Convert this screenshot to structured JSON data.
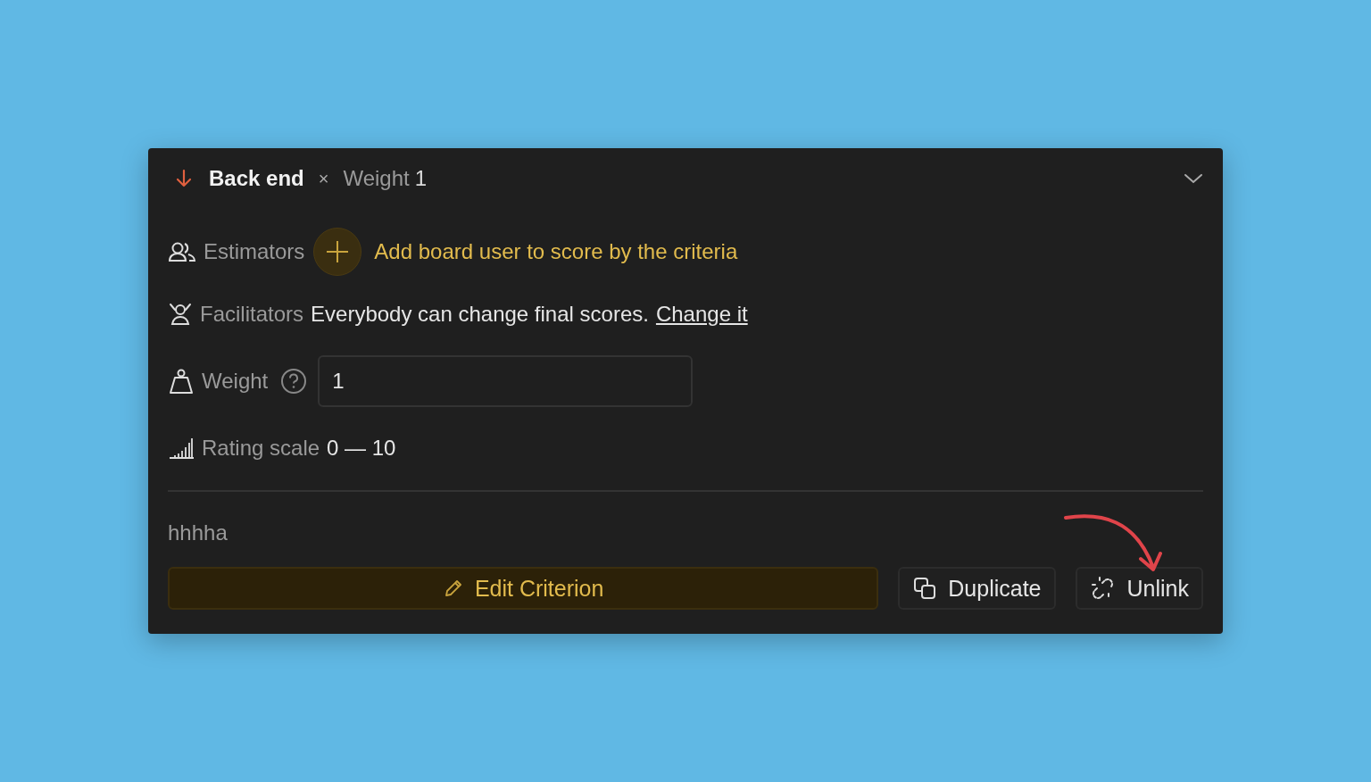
{
  "header": {
    "title": "Back end",
    "separator": "×",
    "weight_label": "Weight",
    "weight_value": "1"
  },
  "estimators": {
    "label": "Estimators",
    "action": "Add board user to score by the criteria"
  },
  "facilitators": {
    "label": "Facilitators",
    "text": "Everybody can change final scores.",
    "link": "Change it"
  },
  "weight": {
    "label": "Weight",
    "value": "1"
  },
  "rating_scale": {
    "label": "Rating scale",
    "value": "0 — 10"
  },
  "description": "hhhha",
  "buttons": [
    {
      "kind": "edit",
      "label": "Edit Criterion"
    },
    {
      "kind": "duplicate",
      "label": "Duplicate"
    },
    {
      "kind": "unlink",
      "label": "Unlink"
    }
  ]
}
